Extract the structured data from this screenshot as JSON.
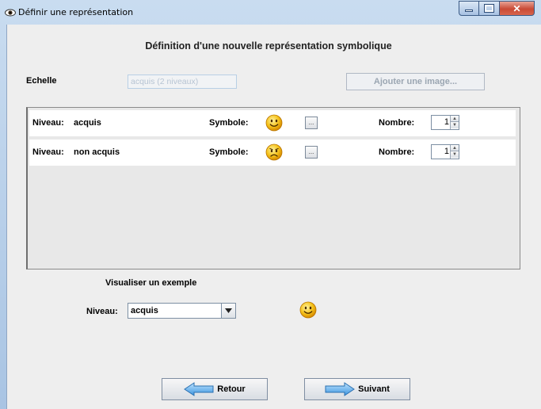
{
  "window": {
    "title": "Définir une représentation",
    "title_icon": "eye-icon",
    "controls": [
      "minimize-icon",
      "maximize-icon",
      "close-icon"
    ]
  },
  "header": {
    "title": "Définition d'une nouvelle représentation symbolique"
  },
  "echelle": {
    "label": "Echelle",
    "value": "acquis (2 niveaux)",
    "add_image_label": "Ajouter une image..."
  },
  "levels": [
    {
      "niveau_label": "Niveau:",
      "niveau_value": "acquis",
      "symbole_label": "Symbole:",
      "symbol": "happy-smiley-icon",
      "nombre_label": "Nombre:",
      "nombre_value": "1"
    },
    {
      "niveau_label": "Niveau:",
      "niveau_value": "non acquis",
      "symbole_label": "Symbole:",
      "symbol": "sad-smiley-icon",
      "nombre_label": "Nombre:",
      "nombre_value": "1"
    }
  ],
  "preview": {
    "title": "Visualiser un exemple",
    "niveau_label": "Niveau:",
    "niveau_value": "acquis",
    "symbol": "happy-smiley-icon"
  },
  "nav": {
    "back_label": "Retour",
    "next_label": "Suivant"
  },
  "colors": {
    "titlebar": "#a9c4e3",
    "panel_bg": "#eeeeee",
    "close_button": "#c94a36",
    "smiley": "#f5c21a"
  }
}
